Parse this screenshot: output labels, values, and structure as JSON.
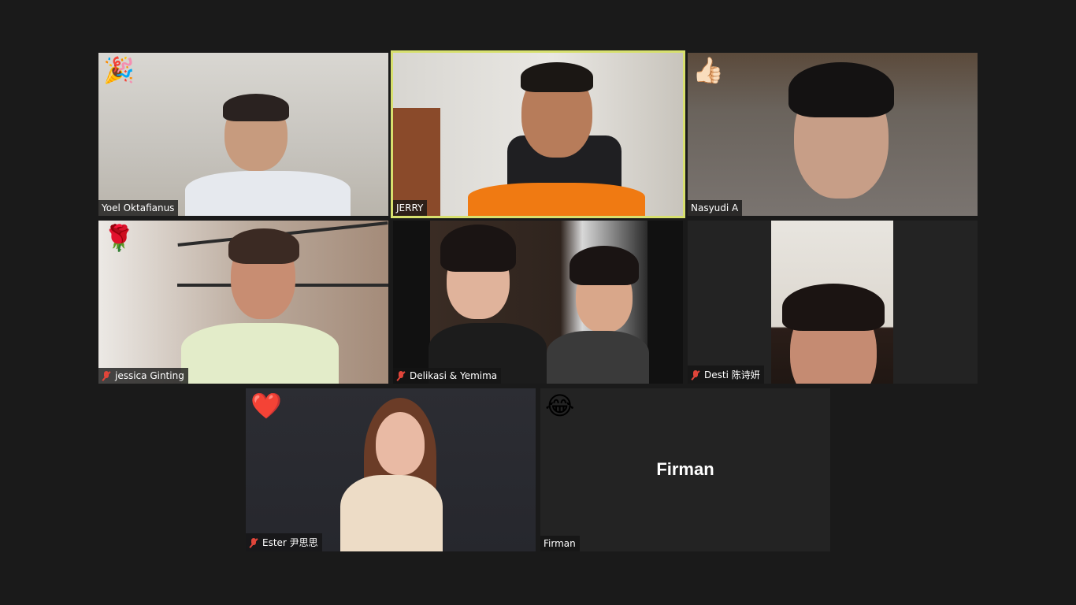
{
  "participants": [
    {
      "name": "Yoel Oktafianus",
      "reaction": "🎉",
      "muted": false,
      "active": false
    },
    {
      "name": "JERRY",
      "reaction": "",
      "muted": false,
      "active": true
    },
    {
      "name": "Nasyudi A",
      "reaction": "👍🏻",
      "muted": false,
      "active": false
    },
    {
      "name": "jessica Ginting",
      "reaction": "🌹",
      "muted": true,
      "active": false
    },
    {
      "name": "Delikasi & Yemima",
      "reaction": "",
      "muted": true,
      "active": false
    },
    {
      "name": "Desti 陈诗妍",
      "reaction": "",
      "muted": true,
      "active": false
    },
    {
      "name": "Ester 尹思思",
      "reaction": "❤️",
      "muted": true,
      "active": false
    },
    {
      "name": "Firman",
      "reaction": "😂",
      "muted": false,
      "active": false,
      "video_off": true,
      "display_name": "Firman"
    }
  ],
  "colors": {
    "active_speaker_border": "#d7e06e",
    "mute_icon": "#e0453a",
    "background": "#1a1a1a"
  }
}
